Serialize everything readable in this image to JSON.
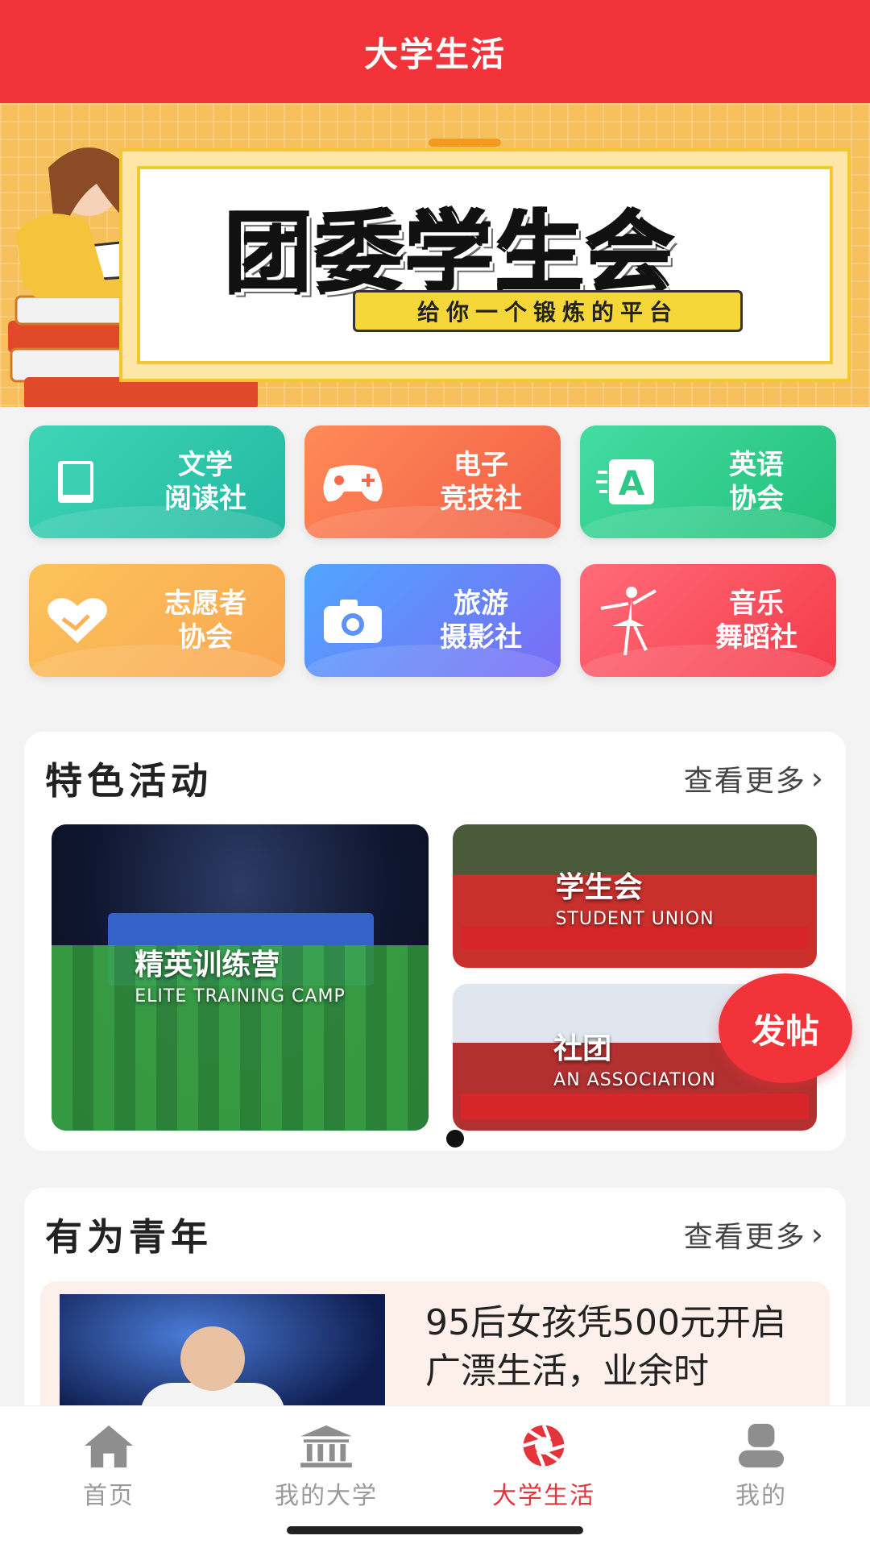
{
  "header": {
    "title": "大学生活"
  },
  "banner": {
    "title": "团委学生会",
    "subtitle": "给你一个锻炼的平台"
  },
  "clubs": [
    {
      "label": "文学\n阅读社",
      "icon": "book-icon"
    },
    {
      "label": "电子\n竞技社",
      "icon": "gamepad-icon"
    },
    {
      "label": "英语\n协会",
      "icon": "letter-a-icon"
    },
    {
      "label": "志愿者\n协会",
      "icon": "heart-hands-icon"
    },
    {
      "label": "旅游\n摄影社",
      "icon": "camera-icon"
    },
    {
      "label": "音乐\n舞蹈社",
      "icon": "dancer-icon"
    }
  ],
  "featured": {
    "title": "特色活动",
    "more": "查看更多",
    "items": [
      {
        "title": "精英训练营",
        "subtitle": "ELITE TRAINING CAMP"
      },
      {
        "title": "学生会",
        "subtitle": "STUDENT UNION"
      },
      {
        "title": "社团",
        "subtitle": "AN ASSOCIATION"
      }
    ]
  },
  "fab": {
    "label": "发帖"
  },
  "youth": {
    "title": "有为青年",
    "more": "查看更多",
    "article": {
      "title": "95后女孩凭500元开启广漂生活，业余时"
    }
  },
  "tabs": [
    {
      "label": "首页",
      "icon": "home-icon",
      "active": false
    },
    {
      "label": "我的大学",
      "icon": "university-icon",
      "active": false
    },
    {
      "label": "大学生活",
      "icon": "aperture-icon",
      "active": true
    },
    {
      "label": "我的",
      "icon": "user-icon",
      "active": false
    }
  ],
  "colors": {
    "brand": "#f2343a",
    "tab_active": "#e2343a",
    "tab_inactive": "#9a9a9a"
  }
}
